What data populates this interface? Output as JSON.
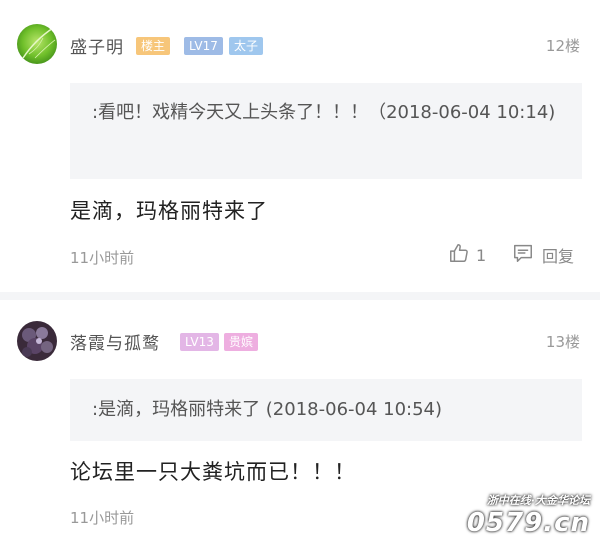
{
  "posts": [
    {
      "username": "盛子明",
      "badges": [
        {
          "text": "楼主",
          "color": "#f7c67a"
        },
        {
          "text": "LV17",
          "color": "#9ebbe6"
        },
        {
          "text": "太子",
          "color": "#9fc7ee"
        }
      ],
      "floor": "12楼",
      "quote": ":看吧！戏精今天又上头条了！！！（2018-06-04 10:14)",
      "content": "是滴，玛格丽特来了",
      "time": "11小时前",
      "like_count": "1",
      "reply_label": "回复"
    },
    {
      "username": "落霞与孤鹜",
      "badges": [
        {
          "text": "LV13",
          "color": "#e3b6e6"
        },
        {
          "text": "贵嫔",
          "color": "#eeaee0"
        }
      ],
      "floor": "13楼",
      "quote": ":是滴，玛格丽特来了 (2018-06-04 10:54)",
      "content": "论坛里一只大粪坑而已！！！",
      "time": "11小时前"
    }
  ],
  "watermark": {
    "line1": "浙中在线·大金华论坛",
    "line2": "0579.cn"
  }
}
